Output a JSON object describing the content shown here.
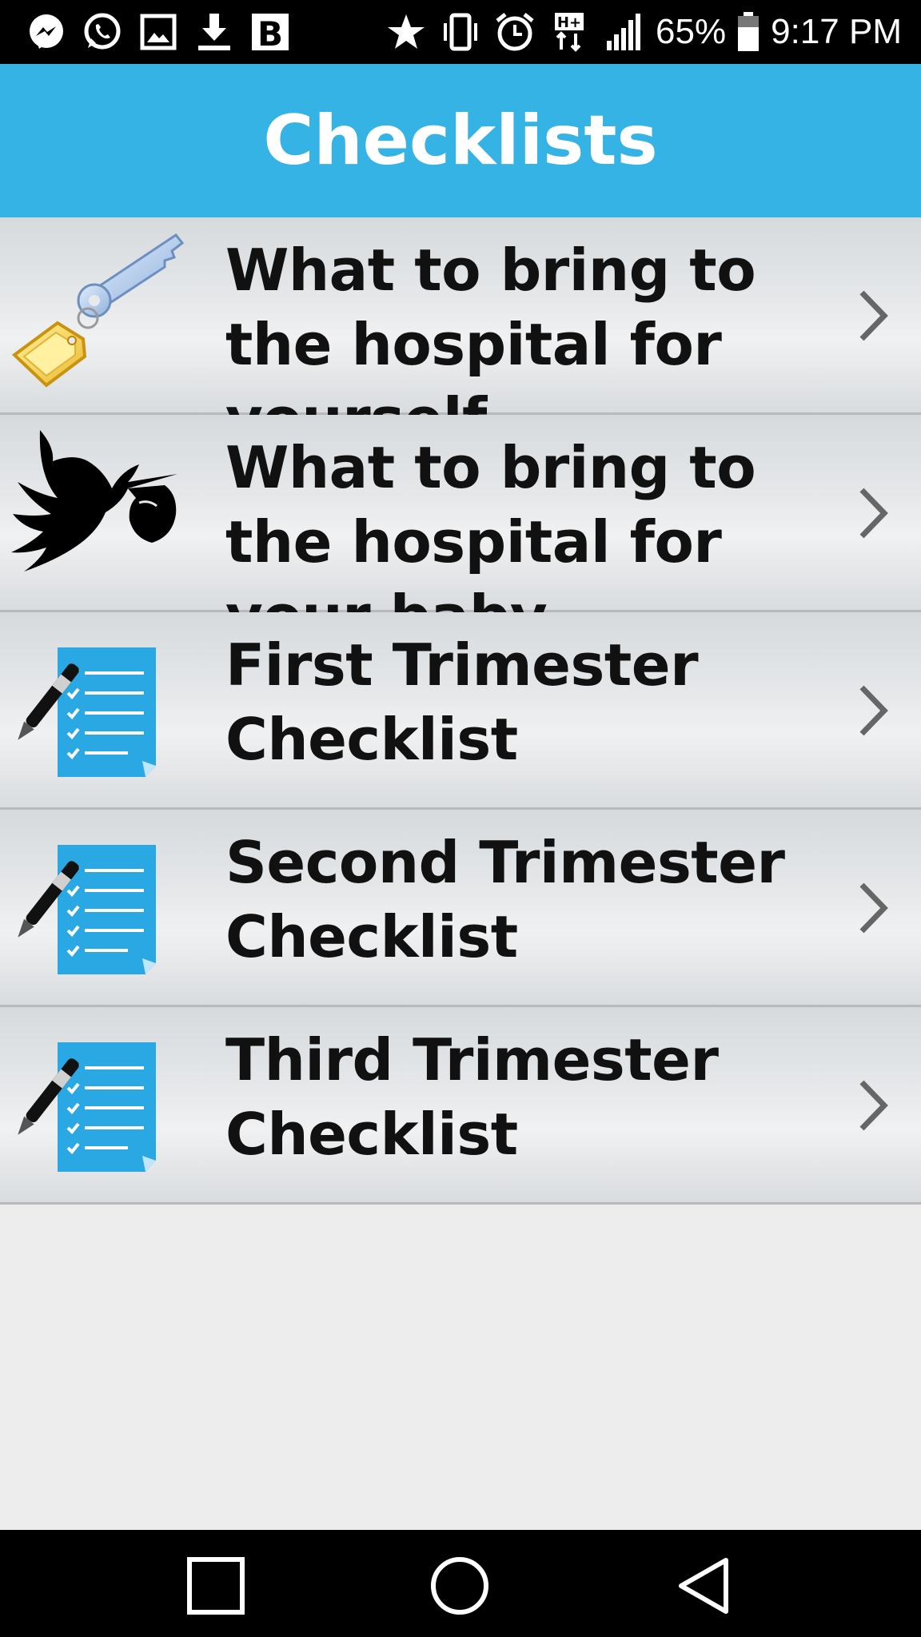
{
  "status_bar": {
    "left_icons": [
      "messenger-icon",
      "whatsapp-icon",
      "gallery-icon",
      "download-icon",
      "b-app-icon"
    ],
    "battery_percent": "65%",
    "time": "9:17 PM",
    "network_badge": "H+"
  },
  "header": {
    "title": "Checklists"
  },
  "checklists": [
    {
      "label": "What to bring to the hospital for yourself",
      "icon": "keys-icon"
    },
    {
      "label": "What to bring to the hospital for your baby",
      "icon": "stork-icon"
    },
    {
      "label": "First Trimester Checklist",
      "icon": "checklist-icon"
    },
    {
      "label": "Second Trimester Checklist",
      "icon": "checklist-icon"
    },
    {
      "label": "Third Trimester Checklist",
      "icon": "checklist-icon"
    }
  ],
  "colors": {
    "header": "#35b3e5",
    "background": "#ededed",
    "text": "#111111"
  },
  "nav_bar": [
    "recent-apps-button",
    "home-button",
    "back-button"
  ]
}
